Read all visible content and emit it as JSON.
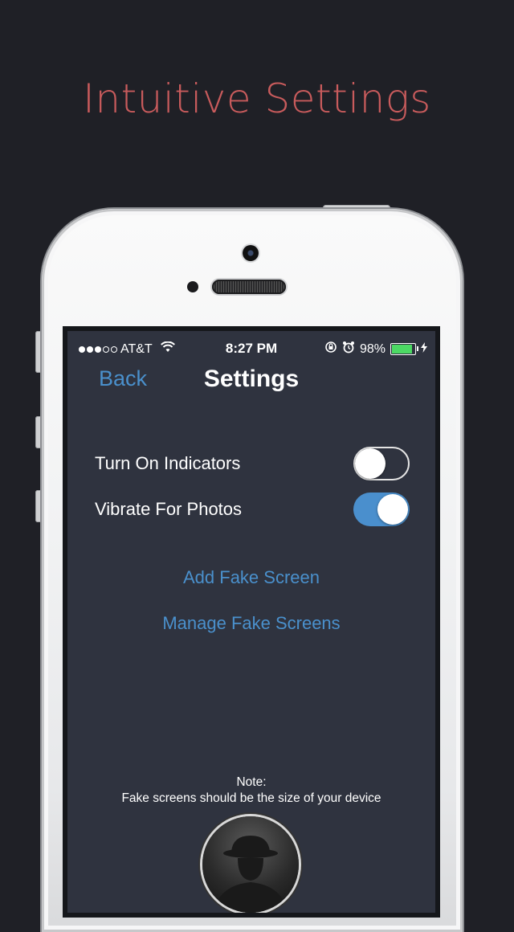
{
  "headline": "Intuitive Settings",
  "status_bar": {
    "carrier": "AT&T",
    "time": "8:27 PM",
    "battery": "98%",
    "battery_level": 0.98,
    "battery_color": "#4cd964"
  },
  "nav": {
    "back_label": "Back",
    "title": "Settings"
  },
  "settings": {
    "indicators": {
      "label": "Turn On Indicators",
      "on": false
    },
    "vibrate": {
      "label": "Vibrate For Photos",
      "on": true
    }
  },
  "actions": {
    "add_fake_screen": "Add Fake Screen",
    "manage_fake_screens": "Manage Fake Screens"
  },
  "note": {
    "title": "Note:",
    "body": "Fake screens should be the size of your device"
  },
  "colors": {
    "accent": "#4a90cc",
    "headline": "#c85b5c",
    "screen_bg": "#2f333f",
    "page_bg": "#1f2026"
  }
}
